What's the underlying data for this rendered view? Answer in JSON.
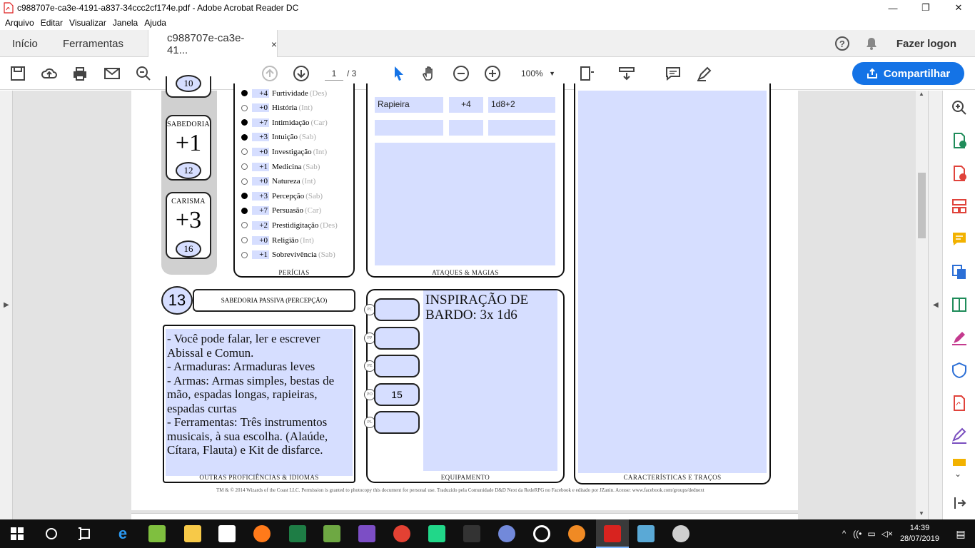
{
  "window": {
    "title": "c988707e-ca3e-4191-a837-34ccc2cf174e.pdf - Adobe Acrobat Reader DC"
  },
  "menu": [
    "Arquivo",
    "Editar",
    "Visualizar",
    "Janela",
    "Ajuda"
  ],
  "tabs": {
    "home": "Início",
    "tools": "Ferramentas",
    "document": "c988707e-ca3e-41...",
    "close": "×"
  },
  "header": {
    "login": "Fazer logon"
  },
  "toolbar": {
    "page_current": "1",
    "page_total": "/ 3",
    "zoom": "100%",
    "share": "Compartilhar"
  },
  "sheet": {
    "abilities": [
      {
        "name": "",
        "mod": "",
        "score": "10"
      },
      {
        "name": "SABEDORIA",
        "mod": "+1",
        "score": "12"
      },
      {
        "name": "CARISMA",
        "mod": "+3",
        "score": "16"
      }
    ],
    "skills": [
      {
        "val": "+4",
        "name": "Furtividade",
        "ab": "(Des)",
        "prof": true
      },
      {
        "val": "+0",
        "name": "História",
        "ab": "(Int)",
        "prof": false
      },
      {
        "val": "+7",
        "name": "Intimidação",
        "ab": "(Car)",
        "prof": true
      },
      {
        "val": "+3",
        "name": "Intuição",
        "ab": "(Sab)",
        "prof": true
      },
      {
        "val": "+0",
        "name": "Investigação",
        "ab": "(Int)",
        "prof": false
      },
      {
        "val": "+1",
        "name": "Medicina",
        "ab": "(Sab)",
        "prof": false
      },
      {
        "val": "+0",
        "name": "Natureza",
        "ab": "(Int)",
        "prof": false
      },
      {
        "val": "+3",
        "name": "Percepção",
        "ab": "(Sab)",
        "prof": true
      },
      {
        "val": "+7",
        "name": "Persuasão",
        "ab": "(Car)",
        "prof": true
      },
      {
        "val": "+2",
        "name": "Prestidigitação",
        "ab": "(Des)",
        "prof": false
      },
      {
        "val": "+0",
        "name": "Religião",
        "ab": "(Int)",
        "prof": false
      },
      {
        "val": "+1",
        "name": "Sobrevivência",
        "ab": "(Sab)",
        "prof": false
      }
    ],
    "skills_caption": "PERÍCIAS",
    "attacks": {
      "name": "Rapieira",
      "bonus": "+4",
      "damage": "1d8+2",
      "caption": "ATAQUES & MAGIAS"
    },
    "passive": {
      "value": "13",
      "label": "SABEDORIA PASSIVA (PERCEPÇÃO)"
    },
    "proficiencies": {
      "text": "- Você pode falar, ler e escrever Abissal e Comun.\n- Armaduras: Armaduras leves\n- Armas: Armas simples, bestas de mão, espadas longas, rapieiras, espadas curtas\n- Ferramentas: Três instrumentos musicais, à sua escolha. (Alaúde, Cítara, Flauta) e Kit de disfarce.",
      "caption": "OUTRAS PROFICIÊNCIAS & IDIOMAS"
    },
    "coins": {
      "labels": [
        "PC",
        "PP",
        "PE",
        "PO",
        "PL"
      ],
      "values": [
        "",
        "",
        "",
        "15",
        ""
      ]
    },
    "equipment": {
      "text": "INSPIRAÇÃO DE BARDO: 3x 1d6",
      "caption": "EQUIPAMENTO"
    },
    "features_caption": "CARACTERÍSTICAS E TRAÇOS",
    "footer": "TM & © 2014 Wizards of the Coast LLC. Permission is granted to photocopy this document for personal use. Traduzido pela Comunidade D&D Next da RedeRPG no Facebook e editado por JZanin. Acesse: www.facebook.com/groups/dednext"
  },
  "taskbar": {
    "time": "14:39",
    "date": "28/07/2019"
  },
  "colors": {
    "accent": "#1473e6",
    "field": "#d6deff"
  }
}
